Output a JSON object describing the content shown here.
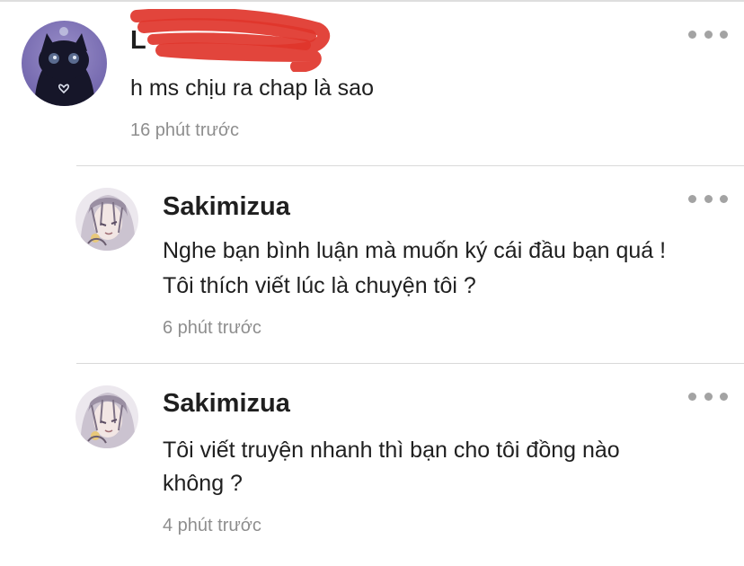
{
  "comments": [
    {
      "username": "L",
      "text_lines": [
        "h ms chịu ra chap là sao"
      ],
      "time": "16 phút trước",
      "avatar_icon": "dark-cat-avatar",
      "redacted": true
    },
    {
      "username": "Sakimizua",
      "text_lines": [
        "Nghe bạn bình luận mà muốn ký cái đầu bạn quá !",
        "Tôi thích viết lúc là chuyện tôi ?"
      ],
      "time": "6 phút trước",
      "avatar_icon": "anime-character-avatar"
    },
    {
      "username": "Sakimizua",
      "text_lines": [
        "Tôi viết truyện nhanh thì bạn cho tôi đồng nào",
        "không ?"
      ],
      "time": "4 phút trước",
      "avatar_icon": "anime-character-avatar"
    }
  ],
  "more_icon": "more-dots-icon",
  "colors": {
    "text": "#1f1f1f",
    "timestamp": "#8e8e8e",
    "divider": "#d9d9d9",
    "redaction": "#e0352b"
  }
}
